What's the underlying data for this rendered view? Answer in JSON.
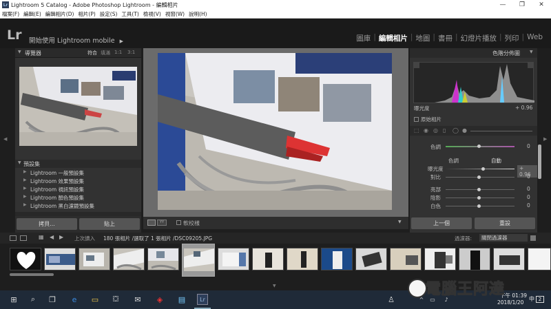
{
  "window": {
    "title": "Lightroom 5 Catalog - Adobe Photoshop Lightroom - 編輯相片",
    "app_icon": "Lr"
  },
  "menu": [
    "檔案(F)",
    "編輯(E)",
    "編輯相片(D)",
    "相片(P)",
    "設定(S)",
    "工具(T)",
    "檢視(V)",
    "視窗(W)",
    "說明(H)"
  ],
  "top": {
    "logo": "Lr",
    "mobile": "開始使用 Lightroom mobile",
    "mobile_arrow": "▶"
  },
  "modules": [
    "圖庫",
    "編輯相片",
    "地圖",
    "書冊",
    "幻燈片播放",
    "列印",
    "Web"
  ],
  "active_module": "編輯相片",
  "navigator": {
    "title": "導覽器",
    "zoom": [
      "符合",
      "填滿",
      "1:1",
      "3:1"
    ]
  },
  "presets": {
    "title": "預設集",
    "items": [
      "Lightroom 一般預設集",
      "Lightroom 效果預設集",
      "Lightroom 視訊預設集",
      "Lightroom 顏色預設集",
      "Lightroom 黑白濾鏡預設集"
    ]
  },
  "left_buttons": {
    "copy": "拷貝...",
    "paste": "貼上"
  },
  "center": {
    "softproof": "軟校樣"
  },
  "right": {
    "histogram_title": "色階分佈圖",
    "exposure_label": "曝光度",
    "exposure_value": "+ 0.96",
    "original_label": "原始相片",
    "tint_label": "色調",
    "tint_value": "0",
    "tone_label": "色調",
    "auto_label": "自動",
    "exposure2_label": "曝光度",
    "exposure2_value": "+ 0.96",
    "contrast_label": "對比",
    "contrast_value": "0",
    "highlights_label": "亮部",
    "highlights_value": "0",
    "shadows_label": "陰影",
    "shadows_value": "0",
    "whites_label": "白色",
    "whites_value": "0",
    "prev_button": "上一個",
    "reset_button": "重設"
  },
  "filmstrip_bar": {
    "import": "上次讀入",
    "count": "180 張相片 /選取了 1 張相片 /DSC09205.JPG",
    "filter_label": "過濾器:",
    "filter_value": "關閉過濾器"
  },
  "taskbar": {
    "time": "下午 01:39",
    "date": "2018/1/20",
    "lang": "中",
    "badge": "2"
  },
  "watermark": "電腦王阿達"
}
